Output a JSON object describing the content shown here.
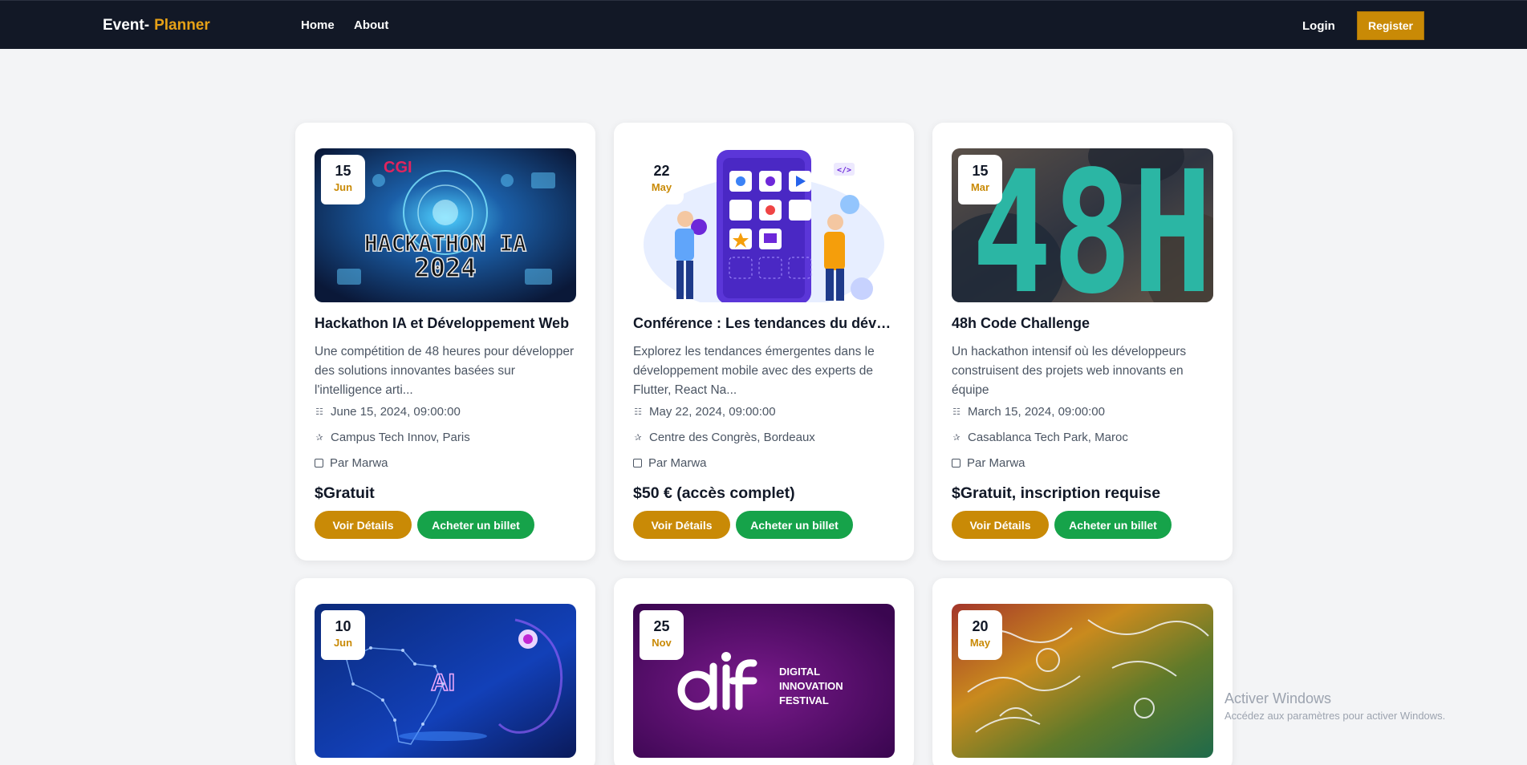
{
  "navbar": {
    "brand_part1": "Event-",
    "brand_part2": "Planner",
    "home": "Home",
    "about": "About",
    "login": "Login",
    "register": "Register"
  },
  "colors": {
    "accent": "#c98a06",
    "success": "#16a34a",
    "nav_bg": "#121826"
  },
  "events": [
    {
      "day": "15",
      "month": "Jun",
      "title": "Hackathon IA et Développement Web",
      "description": "Une compétition de 48 heures pour développer des solutions innovantes basées sur l'intelligence arti...",
      "date": "June 15, 2024, 09:00:00",
      "location": "Campus Tech Innov, Paris",
      "organizer": "Par Marwa",
      "price": "$Gratuit",
      "details_label": "Voir Détails",
      "ticket_label": "Acheter un billet",
      "image_text_1": "HACKATHON IA",
      "image_text_2": "2024",
      "image_logo": "CGI"
    },
    {
      "day": "22",
      "month": "May",
      "title": "Conférence : Les tendances du dévelo...",
      "description": "Explorez les tendances émergentes dans le développement mobile avec des experts de Flutter, React Na...",
      "date": "May 22, 2024, 09:00:00",
      "location": "Centre des Congrès, Bordeaux",
      "organizer": "Par Marwa",
      "price": "$50 € (accès complet)",
      "details_label": "Voir Détails",
      "ticket_label": "Acheter un billet",
      "image_code_tag": "</>"
    },
    {
      "day": "15",
      "month": "Mar",
      "title": "48h Code Challenge",
      "description": "Un hackathon intensif où les développeurs construisent des projets web innovants en équipe",
      "date": "March 15, 2024, 09:00:00",
      "location": "Casablanca Tech Park, Maroc",
      "organizer": "Par Marwa",
      "price": "$Gratuit, inscription requise",
      "details_label": "Voir Détails",
      "ticket_label": "Acheter un billet",
      "image_text": "48H"
    },
    {
      "day": "10",
      "month": "Jun",
      "image_text": "AI"
    },
    {
      "day": "25",
      "month": "Nov",
      "image_line_1": "DIGITAL",
      "image_line_2": "INNOVATION",
      "image_line_3": "FESTIVAL"
    },
    {
      "day": "20",
      "month": "May"
    }
  ],
  "watermark": {
    "title": "Activer Windows",
    "subtitle": "Accédez aux paramètres pour activer Windows."
  }
}
